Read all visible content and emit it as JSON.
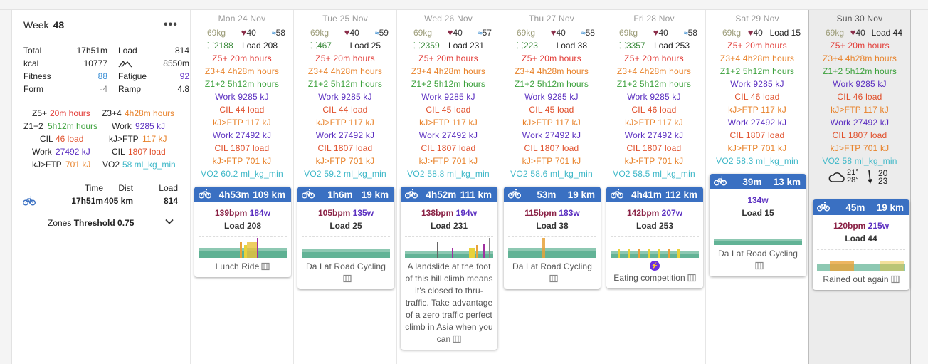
{
  "week": {
    "label": "Week",
    "number": "48",
    "menu_icon": "more-horizontal-icon"
  },
  "summary_stats": {
    "total_label": "Total",
    "total_value": "17h51m",
    "load_label": "Load",
    "load_value": "814",
    "kcal_label": "kcal",
    "kcal_value": "10777",
    "climb_icon": "mountain-icon",
    "climb_value": "8550m",
    "fitness_label": "Fitness",
    "fitness_value": "88",
    "fatigue_label": "Fatigue",
    "fatigue_value": "92",
    "form_label": "Form",
    "form_value": "-4",
    "ramp_label": "Ramp",
    "ramp_value": "4.8"
  },
  "summary_zones": [
    {
      "label": "Z5+",
      "value": "20m hours",
      "color": "#e23b36"
    },
    {
      "label": "Z3+4",
      "value": "4h28m hours",
      "color": "#e8822a"
    },
    {
      "label": "Z1+2",
      "value": "5h12m hours",
      "color": "#3aa03a"
    },
    {
      "label": "Work",
      "value": "9285 kJ",
      "color": "#5b2fc0"
    },
    {
      "label": "CIL",
      "value": "46 load",
      "color": "#e0502c"
    },
    {
      "label": "kJ>FTP",
      "value": "117 kJ",
      "color": "#e8822a"
    },
    {
      "label": "Work",
      "value": "27492 kJ",
      "color": "#5b2fc0"
    },
    {
      "label": "CIL",
      "value": "1807 load",
      "color": "#e0502c"
    },
    {
      "label": "kJ>FTP",
      "value": "701 kJ",
      "color": "#e8822a"
    },
    {
      "label": "VO2",
      "value": "58 ml_kg_min",
      "color": "#3fb8c8"
    }
  ],
  "activity_totals": {
    "time_label": "Time",
    "dist_label": "Dist",
    "load_label": "Load",
    "time": "17h51m",
    "dist": "405 km",
    "load": "814"
  },
  "zones_threshold": {
    "label": "Zones",
    "value": "Threshold 0.75"
  },
  "days": [
    {
      "header": "Mon 24 Nov",
      "weight": "69kg",
      "hr": "40",
      "hrv": "58",
      "steps": "2188",
      "load": "Load 208",
      "lines": [
        {
          "t": "Z5+ 20m hours",
          "c": "red"
        },
        {
          "t": "Z3+4 4h28m hours",
          "c": "orange"
        },
        {
          "t": "Z1+2 5h12m hours",
          "c": "green"
        },
        {
          "t": "Work 9285 kJ",
          "c": "purple"
        },
        {
          "t": "CIL 44 load",
          "c": "cil"
        },
        {
          "t": "kJ>FTP 117 kJ",
          "c": "orange"
        },
        {
          "t": "Work 27492 kJ",
          "c": "purple"
        },
        {
          "t": "CIL 1807 load",
          "c": "cil"
        },
        {
          "t": "kJ>FTP 701 kJ",
          "c": "orange"
        },
        {
          "t": "VO2 60.2 ml_kg_min",
          "c": "teal"
        }
      ],
      "activity": {
        "duration": "4h53m",
        "distance": "109 km",
        "bpm": "139bpm",
        "watts": "184w",
        "load": "Load 208",
        "name": "Lunch Ride"
      }
    },
    {
      "header": "Tue 25 Nov",
      "weight": "69kg",
      "hr": "40",
      "hrv": "59",
      "steps": "467",
      "load": "Load 25",
      "lines": [
        {
          "t": "Z5+ 20m hours",
          "c": "red"
        },
        {
          "t": "Z3+4 4h28m hours",
          "c": "orange"
        },
        {
          "t": "Z1+2 5h12m hours",
          "c": "green"
        },
        {
          "t": "Work 9285 kJ",
          "c": "purple"
        },
        {
          "t": "CIL 44 load",
          "c": "cil"
        },
        {
          "t": "kJ>FTP 117 kJ",
          "c": "orange"
        },
        {
          "t": "Work 27492 kJ",
          "c": "purple"
        },
        {
          "t": "CIL 1807 load",
          "c": "cil"
        },
        {
          "t": "kJ>FTP 701 kJ",
          "c": "orange"
        },
        {
          "t": "VO2 59.2 ml_kg_min",
          "c": "teal"
        }
      ],
      "activity": {
        "duration": "1h6m",
        "distance": "19 km",
        "bpm": "105bpm",
        "watts": "135w",
        "load": "Load 25",
        "name": "Da Lat Road Cycling"
      }
    },
    {
      "header": "Wed 26 Nov",
      "weight": "69kg",
      "hr": "40",
      "hrv": "57",
      "steps": "2359",
      "load": "Load 231",
      "lines": [
        {
          "t": "Z5+ 20m hours",
          "c": "red"
        },
        {
          "t": "Z3+4 4h28m hours",
          "c": "orange"
        },
        {
          "t": "Z1+2 5h12m hours",
          "c": "green"
        },
        {
          "t": "Work 9285 kJ",
          "c": "purple"
        },
        {
          "t": "CIL 45 load",
          "c": "cil"
        },
        {
          "t": "kJ>FTP 117 kJ",
          "c": "orange"
        },
        {
          "t": "Work 27492 kJ",
          "c": "purple"
        },
        {
          "t": "CIL 1807 load",
          "c": "cil"
        },
        {
          "t": "kJ>FTP 701 kJ",
          "c": "orange"
        },
        {
          "t": "VO2 58.8 ml_kg_min",
          "c": "teal"
        }
      ],
      "activity": {
        "duration": "4h52m",
        "distance": "111 km",
        "bpm": "138bpm",
        "watts": "194w",
        "load": "Load 231",
        "name": "A landslide at the foot of this hill climb means it's closed to thru-traffic. Take advantage of a zero traffic perfect climb in Asia when you can"
      }
    },
    {
      "header": "Thu 27 Nov",
      "weight": "69kg",
      "hr": "40",
      "hrv": "58",
      "steps": "223",
      "load": "Load 38",
      "lines": [
        {
          "t": "Z5+ 20m hours",
          "c": "red"
        },
        {
          "t": "Z3+4 4h28m hours",
          "c": "orange"
        },
        {
          "t": "Z1+2 5h12m hours",
          "c": "green"
        },
        {
          "t": "Work 9285 kJ",
          "c": "purple"
        },
        {
          "t": "CIL 45 load",
          "c": "cil"
        },
        {
          "t": "kJ>FTP 117 kJ",
          "c": "orange"
        },
        {
          "t": "Work 27492 kJ",
          "c": "purple"
        },
        {
          "t": "CIL 1807 load",
          "c": "cil"
        },
        {
          "t": "kJ>FTP 701 kJ",
          "c": "orange"
        },
        {
          "t": "VO2 58.6 ml_kg_min",
          "c": "teal"
        }
      ],
      "activity": {
        "duration": "53m",
        "distance": "19 km",
        "bpm": "115bpm",
        "watts": "183w",
        "load": "Load 38",
        "name": "Da Lat Road Cycling"
      }
    },
    {
      "header": "Fri 28 Nov",
      "weight": "69kg",
      "hr": "40",
      "hrv": "58",
      "steps": "3357",
      "load": "Load 253",
      "lines": [
        {
          "t": "Z5+ 20m hours",
          "c": "red"
        },
        {
          "t": "Z3+4 4h28m hours",
          "c": "orange"
        },
        {
          "t": "Z1+2 5h12m hours",
          "c": "green"
        },
        {
          "t": "Work 9285 kJ",
          "c": "purple"
        },
        {
          "t": "CIL 46 load",
          "c": "cil"
        },
        {
          "t": "kJ>FTP 117 kJ",
          "c": "orange"
        },
        {
          "t": "Work 27492 kJ",
          "c": "purple"
        },
        {
          "t": "CIL 1807 load",
          "c": "cil"
        },
        {
          "t": "kJ>FTP 701 kJ",
          "c": "orange"
        },
        {
          "t": "VO2 58.5 ml_kg_min",
          "c": "teal"
        }
      ],
      "activity": {
        "duration": "4h41m",
        "distance": "112 km",
        "bpm": "142bpm",
        "watts": "207w",
        "load": "Load 253",
        "name": "Eating competition"
      }
    },
    {
      "header": "Sat 29 Nov",
      "weight": "69kg",
      "hr": "40",
      "load": "Load 15",
      "lines": [
        {
          "t": "Z5+ 20m hours",
          "c": "red"
        },
        {
          "t": "Z3+4 4h28m hours",
          "c": "orange"
        },
        {
          "t": "Z1+2 5h12m hours",
          "c": "green"
        },
        {
          "t": "Work 9285 kJ",
          "c": "purple"
        },
        {
          "t": "CIL 46 load",
          "c": "cil"
        },
        {
          "t": "kJ>FTP 117 kJ",
          "c": "orange"
        },
        {
          "t": "Work 27492 kJ",
          "c": "purple"
        },
        {
          "t": "CIL 1807 load",
          "c": "cil"
        },
        {
          "t": "kJ>FTP 701 kJ",
          "c": "orange"
        },
        {
          "t": "VO2 58.3 ml_kg_min",
          "c": "teal"
        }
      ],
      "activity": {
        "duration": "39m",
        "distance": "13 km",
        "watts": "134w",
        "load": "Load 15",
        "name": "Da Lat Road Cycling"
      }
    },
    {
      "header": "Sun 30 Nov",
      "weight": "69kg",
      "hr": "40",
      "load": "Load 44",
      "lines": [
        {
          "t": "Z5+ 20m hours",
          "c": "red"
        },
        {
          "t": "Z3+4 4h28m hours",
          "c": "orange"
        },
        {
          "t": "Z1+2 5h12m hours",
          "c": "green"
        },
        {
          "t": "Work 9285 kJ",
          "c": "purple"
        },
        {
          "t": "CIL 46 load",
          "c": "cil"
        },
        {
          "t": "kJ>FTP 117 kJ",
          "c": "orange"
        },
        {
          "t": "Work 27492 kJ",
          "c": "purple"
        },
        {
          "t": "CIL 1807 load",
          "c": "cil"
        },
        {
          "t": "kJ>FTP 701 kJ",
          "c": "orange"
        },
        {
          "t": "VO2 58 ml_kg_min",
          "c": "teal"
        }
      ],
      "weather": {
        "icon": "cloud-icon",
        "temp_high": "21°",
        "temp_low": "28°",
        "wind_icon": "wind-arrow-icon",
        "wind_a": "20",
        "wind_b": "23"
      },
      "activity": {
        "duration": "45m",
        "distance": "19 km",
        "bpm": "120bpm",
        "watts": "215w",
        "load": "Load 44",
        "name": "Rained out again"
      }
    }
  ]
}
